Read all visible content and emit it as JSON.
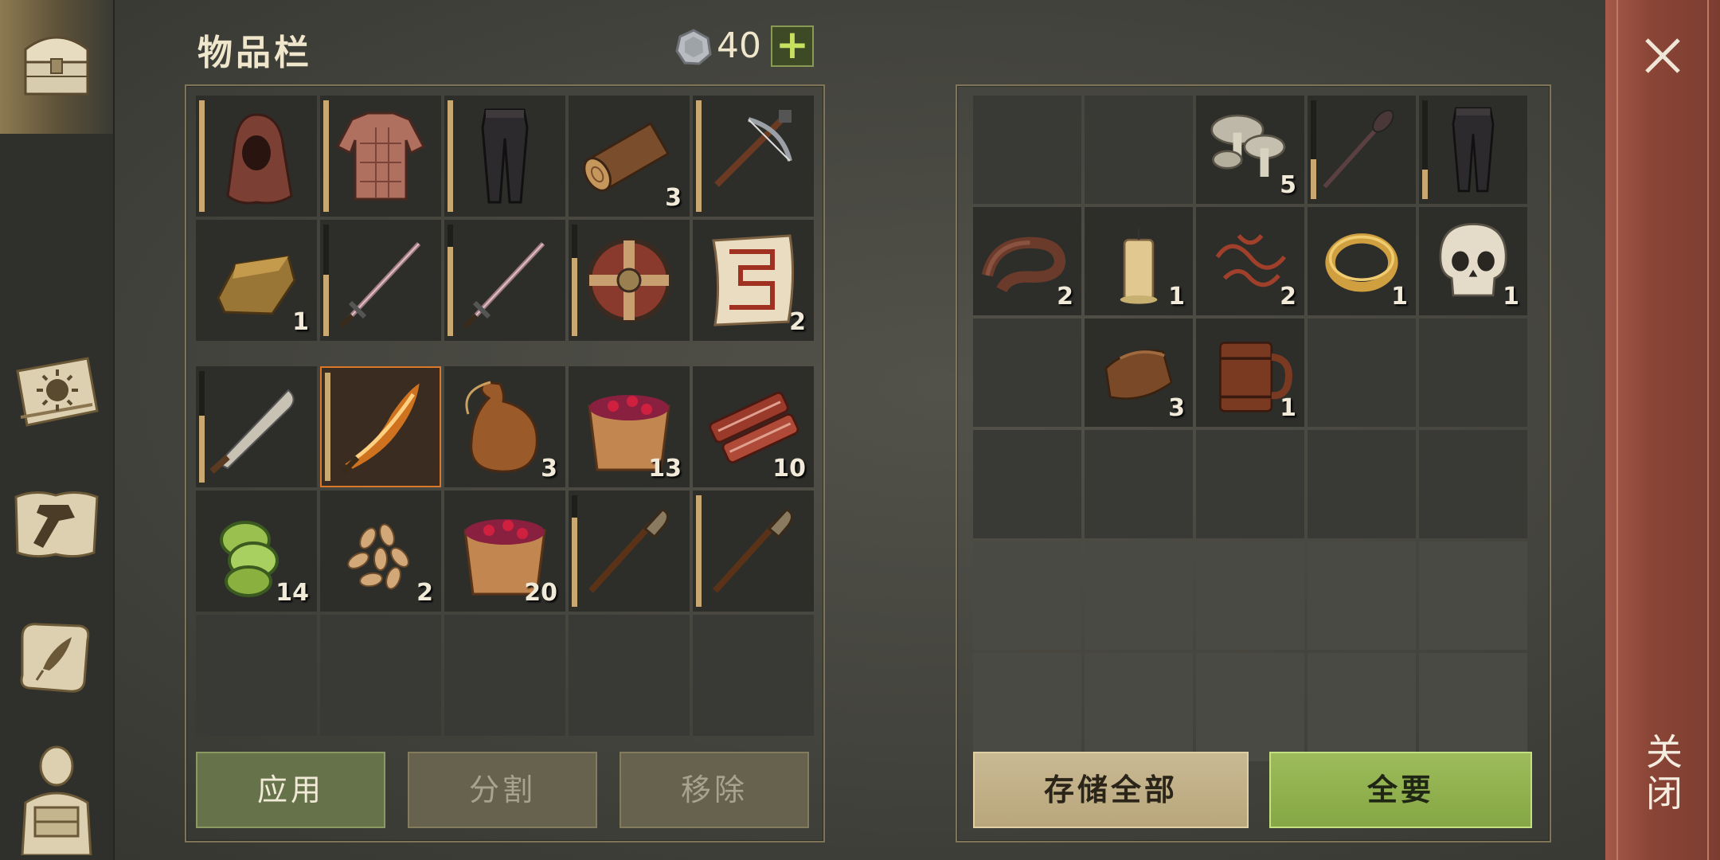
{
  "header": {
    "title": "物品栏",
    "currency_icon": "silver-coin-icon",
    "currency_count": "40",
    "add_label": "+"
  },
  "sidebar": {
    "items": [
      {
        "name": "chest-icon",
        "active": true
      },
      {
        "name": "sun-book-icon"
      },
      {
        "name": "crafting-hammer-icon"
      },
      {
        "name": "quest-scroll-icon"
      },
      {
        "name": "character-icon"
      }
    ]
  },
  "inventory": {
    "equipment_rows": [
      [
        {
          "item": "hood-icon",
          "qty": "",
          "durability": 1.0
        },
        {
          "item": "padded-tunic-icon",
          "qty": "",
          "durability": 1.0
        },
        {
          "item": "pants-icon",
          "qty": "",
          "durability": 1.0
        },
        {
          "item": "log-icon",
          "qty": "3"
        },
        {
          "item": "crossbow-icon",
          "qty": "",
          "durability": 1.0
        }
      ],
      [
        {
          "item": "ingot-icon",
          "qty": "1"
        },
        {
          "item": "sword-icon",
          "qty": "",
          "durability": 0.55
        },
        {
          "item": "sword-icon",
          "qty": "",
          "durability": 0.8
        },
        {
          "item": "round-shield-icon",
          "qty": "",
          "durability": 0.7
        },
        {
          "item": "map-scroll-icon",
          "qty": "2"
        }
      ]
    ],
    "bag_rows": [
      [
        {
          "item": "machete-icon",
          "qty": "",
          "durability": 0.6
        },
        {
          "item": "flaming-sword-icon",
          "qty": "",
          "durability": 1.0,
          "selected": true
        },
        {
          "item": "waterskin-icon",
          "qty": "3"
        },
        {
          "item": "berry-bucket-icon",
          "qty": "13"
        },
        {
          "item": "raw-meat-icon",
          "qty": "10"
        }
      ],
      [
        {
          "item": "cucumber-slices-icon",
          "qty": "14"
        },
        {
          "item": "seeds-icon",
          "qty": "2"
        },
        {
          "item": "berry-bucket-icon",
          "qty": "20"
        },
        {
          "item": "torch-icon",
          "qty": "",
          "durability": 0.8
        },
        {
          "item": "torch-icon",
          "qty": "",
          "durability": 1.0
        }
      ],
      [
        {
          "item": "",
          "qty": ""
        },
        {
          "item": "",
          "qty": ""
        },
        {
          "item": "",
          "qty": ""
        },
        {
          "item": "",
          "qty": ""
        },
        {
          "item": "",
          "qty": ""
        }
      ]
    ],
    "buttons": {
      "apply": "应用",
      "split": "分割",
      "remove": "移除"
    }
  },
  "container": {
    "rows": [
      [
        {
          "item": "",
          "qty": ""
        },
        {
          "item": "",
          "qty": ""
        },
        {
          "item": "mushrooms-icon",
          "qty": "5"
        },
        {
          "item": "mace-spear-icon",
          "qty": "",
          "durability": 0.4
        },
        {
          "item": "pants-icon",
          "qty": "",
          "durability": 0.3
        }
      ],
      [
        {
          "item": "leather-belt-icon",
          "qty": "2"
        },
        {
          "item": "candle-icon",
          "qty": "1"
        },
        {
          "item": "sinew-icon",
          "qty": "2"
        },
        {
          "item": "gold-ring-icon",
          "qty": "1"
        },
        {
          "item": "skull-icon",
          "qty": "1"
        }
      ],
      [
        {
          "item": "",
          "qty": ""
        },
        {
          "item": "leather-scraps-icon",
          "qty": "3"
        },
        {
          "item": "wooden-mug-icon",
          "qty": "1"
        },
        {
          "item": "",
          "qty": ""
        },
        {
          "item": "",
          "qty": ""
        }
      ],
      [
        {
          "item": "",
          "qty": ""
        },
        {
          "item": "",
          "qty": ""
        },
        {
          "item": "",
          "qty": ""
        },
        {
          "item": "",
          "qty": ""
        },
        {
          "item": "",
          "qty": ""
        }
      ],
      [
        {
          "item": "",
          "qty": ""
        },
        {
          "item": "",
          "qty": ""
        },
        {
          "item": "",
          "qty": ""
        },
        {
          "item": "",
          "qty": ""
        },
        {
          "item": "",
          "qty": ""
        }
      ],
      [
        {
          "item": "",
          "qty": ""
        },
        {
          "item": "",
          "qty": ""
        },
        {
          "item": "",
          "qty": ""
        },
        {
          "item": "",
          "qty": ""
        },
        {
          "item": "",
          "qty": ""
        }
      ]
    ],
    "buttons": {
      "store_all": "存储全部",
      "take_all": "全要"
    }
  },
  "close": {
    "label": "关闭",
    "icon": "close-icon"
  },
  "colors": {
    "accent_green": "#86a745",
    "durability_bar": "#c9a872",
    "selected_border": "#d9772a",
    "close_panel": "#8a4536"
  }
}
